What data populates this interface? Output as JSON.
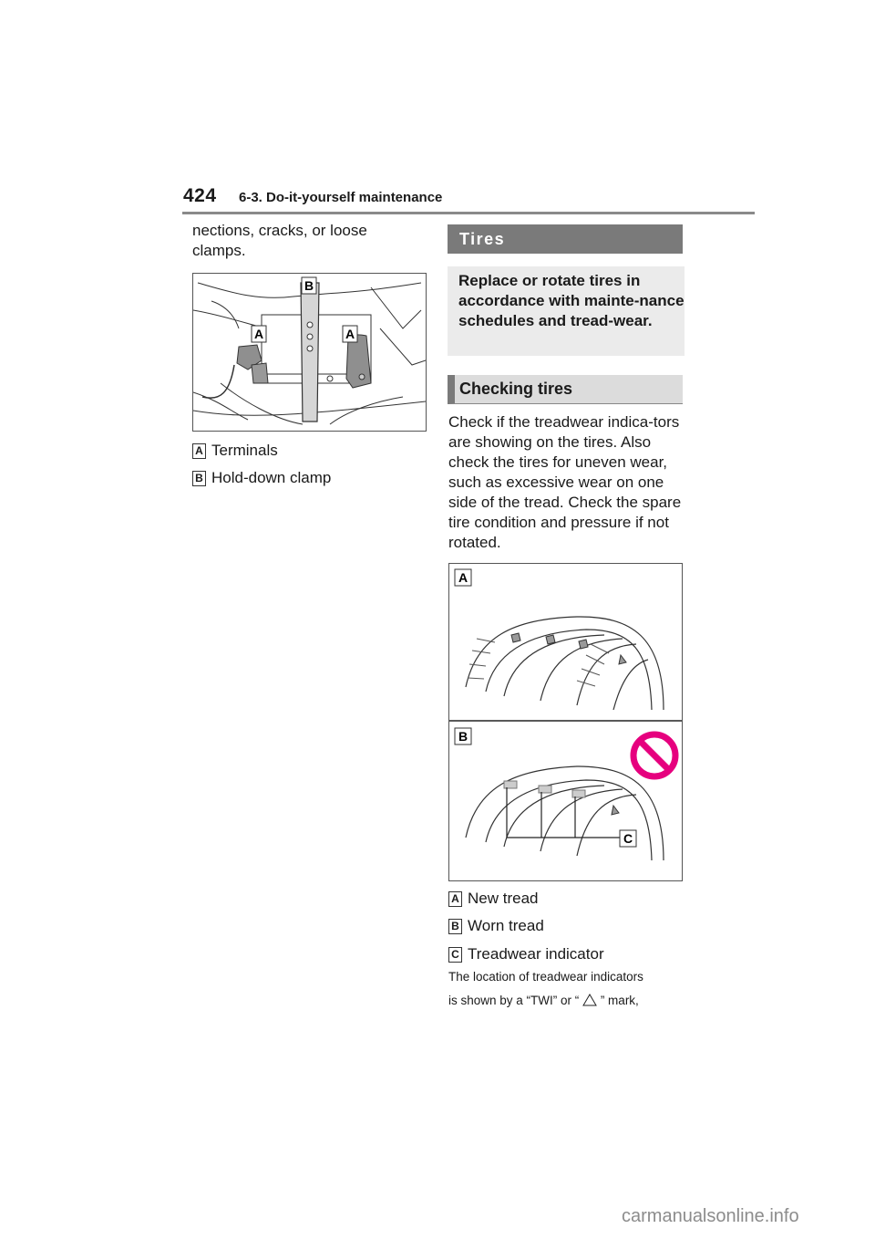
{
  "header": {
    "page_number": "424",
    "section": "6-3. Do-it-yourself maintenance"
  },
  "left_column": {
    "intro_text": "nections, cracks, or loose clamps.",
    "figure": {
      "callouts": [
        "B",
        "A",
        "A"
      ],
      "icon": "battery-illustration"
    },
    "legend": [
      {
        "key": "A",
        "label": "Terminals"
      },
      {
        "key": "B",
        "label": "Hold-down clamp"
      }
    ]
  },
  "right_column": {
    "heading": "Tires",
    "summary": "Replace or rotate tires in accordance with mainte-nance schedules and tread-wear.",
    "subheading": "Checking tires",
    "body": "Check if the treadwear indica-tors are showing on the tires. Also check the tires for uneven wear, such as excessive wear on one side of the tread. Check the spare tire condition and pressure if not rotated.",
    "figure": {
      "callouts": [
        "A",
        "B",
        "C"
      ],
      "prohibited_color": "#e6007e",
      "icon": "tire-tread-illustration"
    },
    "legend": [
      {
        "key": "A",
        "label": "New tread"
      },
      {
        "key": "B",
        "label": "Worn tread"
      },
      {
        "key": "C",
        "label": "Treadwear indicator"
      }
    ],
    "note_line1": "The location of treadwear indicators",
    "note_line2_prefix": "is shown by a “TWI” or “",
    "note_line2_suffix": "” mark,"
  },
  "watermark": "carmanualsonline.info"
}
